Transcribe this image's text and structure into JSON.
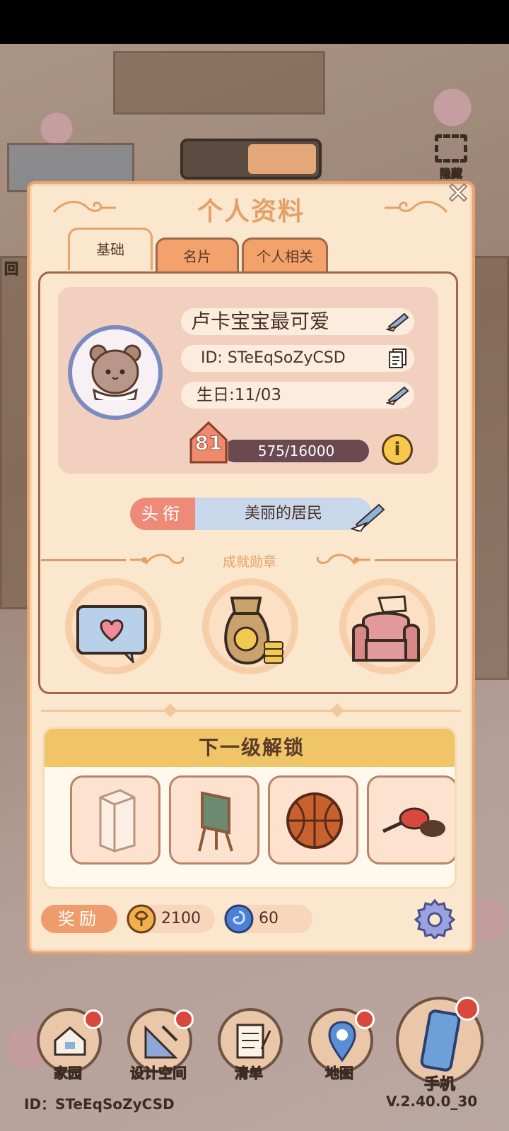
{
  "panel": {
    "title": "个人资料",
    "close_icon": "×",
    "tabs": [
      {
        "label": "基础",
        "active": true
      },
      {
        "label": "名片",
        "active": false
      },
      {
        "label": "个人相关",
        "active": false
      }
    ]
  },
  "profile": {
    "nickname": "卢卡宝宝最可爱",
    "id_text": "ID: STeEqSoZyCSD",
    "birthday": "生日:11/03",
    "level": "81",
    "xp_text": "575/16000",
    "xp_fraction": 0.036,
    "info_glyph": "i"
  },
  "title_row": {
    "label": "头衔",
    "value": "美丽的居民"
  },
  "achievements": {
    "title": "成就勋章",
    "badges": [
      "chat-bubble-heart",
      "money-bag",
      "pink-armchair"
    ]
  },
  "unlock": {
    "header": "下一级解锁",
    "items": [
      "wardrobe",
      "easel-board",
      "basketball",
      "ping-pong-paddle"
    ]
  },
  "rewards": {
    "label": "奖励",
    "coins": "2100",
    "gems": "60"
  },
  "top": {
    "hide_label": "隐藏"
  },
  "nav": {
    "items": [
      {
        "label": "家园"
      },
      {
        "label": "设计空间"
      },
      {
        "label": "清单"
      },
      {
        "label": "地图"
      },
      {
        "label": "手机"
      }
    ],
    "footer_id": "ID：STeEqSoZyCSD",
    "version": "V.2.40.0_30"
  },
  "side": {
    "left_label": "回"
  },
  "colors": {
    "accent_orange": "#e3a168",
    "panel_bg": "#fbe7cd",
    "title_pink": "#ee8b78",
    "unlock_yellow": "#f0c567"
  }
}
